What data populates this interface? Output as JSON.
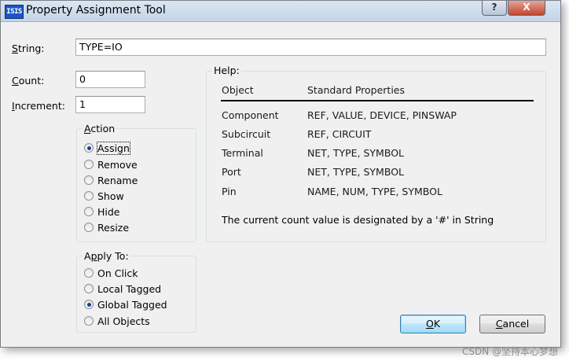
{
  "window": {
    "title": "Property Assignment Tool",
    "app_icon_text": "ISIS",
    "help_button": "?",
    "close_button": "X"
  },
  "fields": {
    "string_label_underlined": "S",
    "string_label_rest": "tring:",
    "string_value": "TYPE=IO",
    "count_label_underlined": "C",
    "count_label_rest": "ount:",
    "count_value": "0",
    "increment_label_underlined": "I",
    "increment_label_rest": "ncrement:",
    "increment_value": "1"
  },
  "action": {
    "title_underlined": "A",
    "title_rest": "ction",
    "options": [
      {
        "label": "Assign",
        "checked": true
      },
      {
        "label": "Remove",
        "checked": false
      },
      {
        "label": "Rename",
        "checked": false
      },
      {
        "label": "Show",
        "checked": false
      },
      {
        "label": "Hide",
        "checked": false
      },
      {
        "label": "Resize",
        "checked": false
      }
    ]
  },
  "apply_to": {
    "title_prefix": "A",
    "title_underlined": "p",
    "title_rest": "ply To:",
    "options": [
      {
        "label": "On Click",
        "checked": false
      },
      {
        "label": "Local Tagged",
        "checked": false
      },
      {
        "label": "Global Tagged",
        "checked": true
      },
      {
        "label": "All Objects",
        "checked": false
      }
    ]
  },
  "help": {
    "title": "Help:",
    "header_object": "Object",
    "header_props": "Standard Properties",
    "rows": [
      {
        "object": "Component",
        "props": "REF, VALUE, DEVICE, PINSWAP"
      },
      {
        "object": "Subcircuit",
        "props": "REF, CIRCUIT"
      },
      {
        "object": "Terminal",
        "props": "NET, TYPE, SYMBOL"
      },
      {
        "object": "Port",
        "props": "NET, TYPE, SYMBOL"
      },
      {
        "object": "Pin",
        "props": "NAME, NUM, TYPE, SYMBOL"
      }
    ],
    "note": "The current count value is designated by a '#' in String"
  },
  "buttons": {
    "ok_underlined": "O",
    "ok_rest": "K",
    "cancel_underlined": "C",
    "cancel_rest": "ancel"
  },
  "watermark": "CSDN @坚持本心梦想"
}
